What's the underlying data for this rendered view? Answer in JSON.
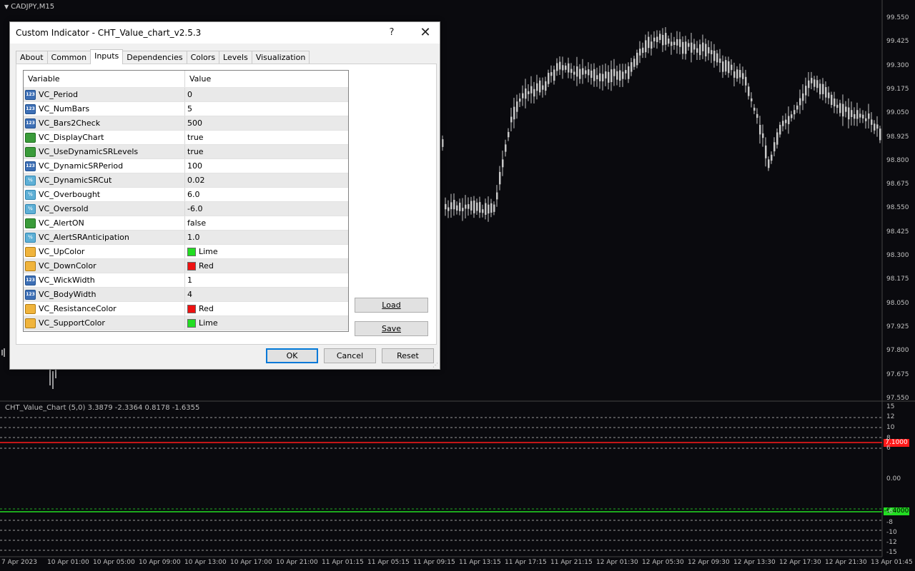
{
  "chart": {
    "symbol": "CADJPY,M15",
    "price_labels": [
      "99.550",
      "99.425",
      "99.300",
      "99.175",
      "99.050",
      "98.925",
      "98.800",
      "98.675",
      "98.550",
      "98.425",
      "98.300",
      "98.175",
      "98.050",
      "97.925",
      "97.800",
      "97.675",
      "97.550"
    ],
    "indicator_label": "CHT_Value_Chart (5,0) 3.3879 -2.3364 0.8178 -1.6355",
    "sub_labels": [
      "15",
      "12",
      "10",
      "8",
      "6",
      "0.00",
      "-6",
      "-8",
      "-10",
      "-12",
      "-15"
    ],
    "level_high": "7.1000",
    "level_low": "-6.4000",
    "time_labels": [
      "7 Apr 2023",
      "10 Apr 01:00",
      "10 Apr 05:00",
      "10 Apr 09:00",
      "10 Apr 13:00",
      "10 Apr 17:00",
      "10 Apr 21:00",
      "11 Apr 01:15",
      "11 Apr 05:15",
      "11 Apr 09:15",
      "11 Apr 13:15",
      "11 Apr 17:15",
      "11 Apr 21:15",
      "12 Apr 01:30",
      "12 Apr 05:30",
      "12 Apr 09:30",
      "12 Apr 13:30",
      "12 Apr 17:30",
      "12 Apr 21:30",
      "13 Apr 01:45"
    ],
    "colors": {
      "background": "#0a0a0e",
      "candles": "#c8c8c8",
      "high_level": "#ff1a1a",
      "low_level": "#22dd22"
    }
  },
  "dialog": {
    "title": "Custom Indicator - CHT_Value_chart_v2.5.3",
    "help": "?",
    "close": "✕",
    "tabs": [
      {
        "label": "About",
        "active": false
      },
      {
        "label": "Common",
        "active": false
      },
      {
        "label": "Inputs",
        "active": true
      },
      {
        "label": "Dependencies",
        "active": false
      },
      {
        "label": "Colors",
        "active": false
      },
      {
        "label": "Levels",
        "active": false
      },
      {
        "label": "Visualization",
        "active": false
      }
    ],
    "columns": {
      "variable": "Variable",
      "value": "Value"
    },
    "rows": [
      {
        "icon": "int",
        "icon_text": "123",
        "name": "VC_Period",
        "value": "0"
      },
      {
        "icon": "int",
        "icon_text": "123",
        "name": "VC_NumBars",
        "value": "5"
      },
      {
        "icon": "int",
        "icon_text": "123",
        "name": "VC_Bars2Check",
        "value": "500"
      },
      {
        "icon": "bool",
        "icon_text": "",
        "name": "VC_DisplayChart",
        "value": "true"
      },
      {
        "icon": "bool",
        "icon_text": "",
        "name": "VC_UseDynamicSRLevels",
        "value": "true"
      },
      {
        "icon": "int",
        "icon_text": "123",
        "name": "VC_DynamicSRPeriod",
        "value": "100"
      },
      {
        "icon": "double",
        "icon_text": "½",
        "name": "VC_DynamicSRCut",
        "value": "0.02"
      },
      {
        "icon": "double",
        "icon_text": "½",
        "name": "VC_Overbought",
        "value": "6.0"
      },
      {
        "icon": "double",
        "icon_text": "½",
        "name": "VC_Oversold",
        "value": "-6.0"
      },
      {
        "icon": "bool",
        "icon_text": "",
        "name": "VC_AlertON",
        "value": "false"
      },
      {
        "icon": "double",
        "icon_text": "½",
        "name": "VC_AlertSRAnticipation",
        "value": "1.0"
      },
      {
        "icon": "color",
        "icon_text": "",
        "name": "VC_UpColor",
        "value": "Lime",
        "swatch": "#22dd22"
      },
      {
        "icon": "color",
        "icon_text": "",
        "name": "VC_DownColor",
        "value": "Red",
        "swatch": "#ee1111"
      },
      {
        "icon": "int",
        "icon_text": "123",
        "name": "VC_WickWidth",
        "value": "1"
      },
      {
        "icon": "int",
        "icon_text": "123",
        "name": "VC_BodyWidth",
        "value": "4"
      },
      {
        "icon": "color",
        "icon_text": "",
        "name": "VC_ResistanceColor",
        "value": "Red",
        "swatch": "#ee1111"
      },
      {
        "icon": "color",
        "icon_text": "",
        "name": "VC_SupportColor",
        "value": "Lime",
        "swatch": "#22dd22"
      }
    ],
    "buttons": {
      "load": "Load",
      "save": "Save",
      "ok": "OK",
      "cancel": "Cancel",
      "reset": "Reset"
    }
  }
}
